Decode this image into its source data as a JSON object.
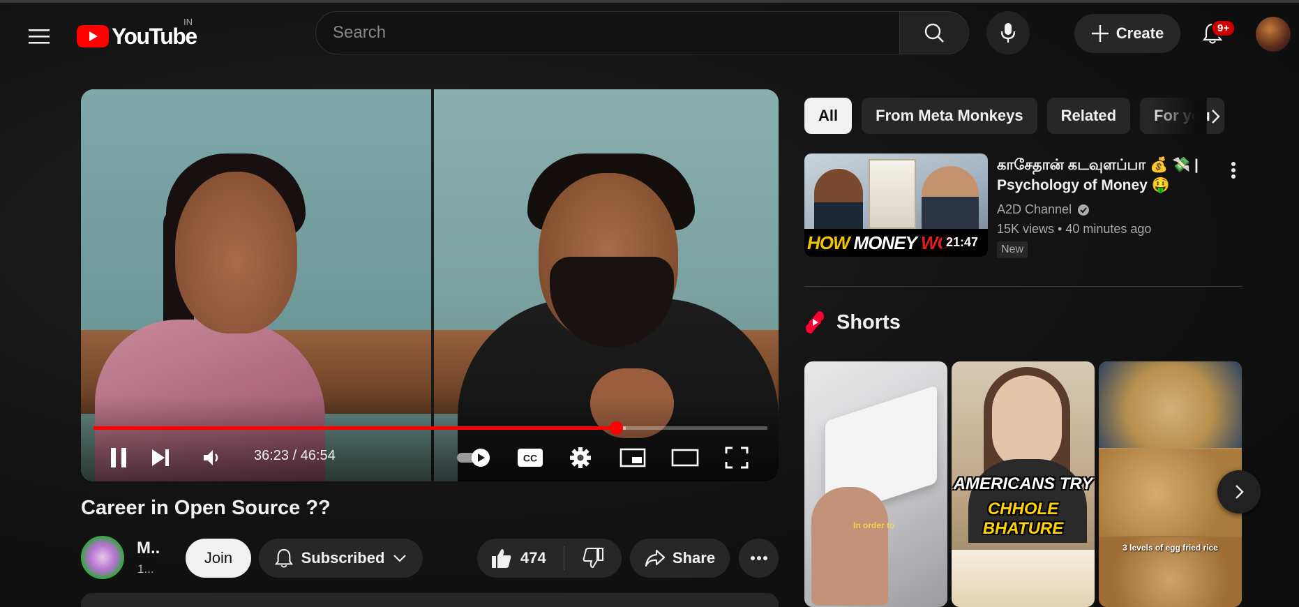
{
  "header": {
    "logo_text": "YouTube",
    "country_code": "IN",
    "search_placeholder": "Search",
    "create_label": "Create",
    "notification_count": "9+"
  },
  "player": {
    "current_time": "36:23",
    "duration": "46:54",
    "time_display": "36:23 / 46:54",
    "progress_fraction": 0.7758,
    "buffered_fraction": 0.79,
    "autoplay": "on",
    "cc_label": "CC"
  },
  "video": {
    "title": "Career in Open Source ??",
    "channel_name": "M..",
    "channel_subs": "1...",
    "join_label": "Join",
    "subscribed_label": "Subscribed",
    "like_count": "474",
    "share_label": "Share"
  },
  "chips": [
    {
      "label": "All",
      "active": true
    },
    {
      "label": "From Meta Monkeys",
      "active": false
    },
    {
      "label": "Related",
      "active": false
    },
    {
      "label": "For you",
      "active": false
    }
  ],
  "recommendation": {
    "title": "காசேதான் கடவுளப்பா 💰 💸 | Psychology of Money 🤑",
    "channel": "A2D Channel",
    "views": "15K views",
    "age": "40 minutes ago",
    "meta": "15K views • 40 minutes ago",
    "badge": "New",
    "duration": "21:47",
    "thumb_text_1": "HOW",
    "thumb_text_2": "MONEY",
    "thumb_text_3": "WO"
  },
  "shorts": {
    "title": "Shorts",
    "items": [
      {
        "caption": "In order to"
      },
      {
        "caption_line1": "AMERICANS TRY",
        "caption_line2": "CHHOLE BHATURE"
      },
      {
        "caption": "3 levels of egg fried rice"
      }
    ]
  },
  "colors": {
    "brand_red": "#ff0000",
    "background": "#0f0f0f",
    "surface": "#272727",
    "text_primary": "#f1f1f1",
    "text_secondary": "#aaaaaa"
  }
}
